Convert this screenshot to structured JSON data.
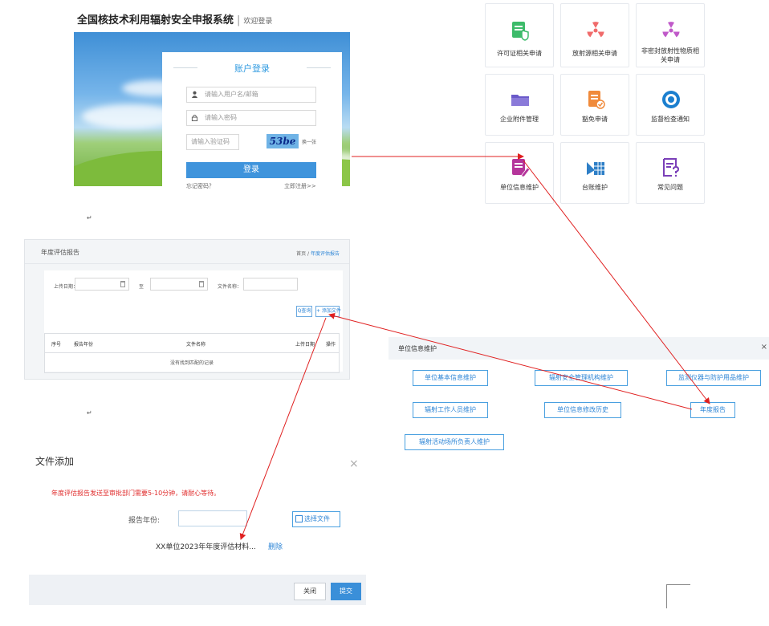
{
  "login": {
    "system_title": "全国核技术利用辐射安全申报系统",
    "separator": "|",
    "welcome": "欢迎登录",
    "card_title": "账户登录",
    "username_placeholder": "请输入用户名/邮箱",
    "password_placeholder": "请输入密码",
    "captcha_placeholder": "请输入验证码",
    "captcha_text": "53be",
    "captcha_refresh": "换一张",
    "login_button": "登录",
    "forgot_link": "忘记密码？",
    "register_link": "立即注册>>"
  },
  "tiles": [
    {
      "label": "许可证相关申请",
      "icon": "license-shield-icon"
    },
    {
      "label": "放射源相关申请",
      "icon": "radiation-icon"
    },
    {
      "label": "非密封放射性物质相关申请",
      "label_line1": "非密封放射性物质相",
      "label_line2": "关申请",
      "icon": "radiation-icon"
    },
    {
      "label": "企业附件管理",
      "icon": "folder-icon"
    },
    {
      "label": "豁免申请",
      "icon": "document-check-icon"
    },
    {
      "label": "监督检查通知",
      "icon": "eye-icon"
    },
    {
      "label": "单位信息维护",
      "icon": "document-edit-icon"
    },
    {
      "label": "台账维护",
      "icon": "ledger-icon"
    },
    {
      "label": "常见问题",
      "icon": "document-question-icon"
    }
  ],
  "report": {
    "title": "年度评估报告",
    "breadcrumb_home": "首页",
    "breadcrumb_sep": "/",
    "breadcrumb_current": "年度评估报告",
    "upload_date_label": "上传日期：",
    "to_label": "至",
    "file_name_label": "文件名称：",
    "query_button": "Q查询",
    "add_file_button": "+ 添加文件",
    "columns": [
      "序号",
      "报告年份",
      "文件名称",
      "上传日期",
      "操作"
    ],
    "empty_text": "没有找到匹配的记录"
  },
  "unit_info": {
    "title": "单位信息维护",
    "close": "×",
    "buttons": [
      "单位基本信息维护",
      "辐射安全管理机构维护",
      "监测仪器与防护用品维护",
      "辐射工作人员维护",
      "单位信息修改历史",
      "年度报告",
      "辐射活动场所负责人维护"
    ]
  },
  "dialog": {
    "title": "文件添加",
    "close": "×",
    "warning": "年度评估报告发送至审批部门需要5-10分钟，请耐心等待。",
    "year_label": "报告年份:",
    "choose_file": "选择文件",
    "file_name": "XX单位2023年年度评估材料...",
    "delete": "删除",
    "close_button": "关闭",
    "submit_button": "提交"
  },
  "pilcrow": "↵",
  "colors": {
    "accent": "#3a8fd9",
    "annotation_arrow": "#e02020",
    "warning_text": "#e02c2c"
  }
}
